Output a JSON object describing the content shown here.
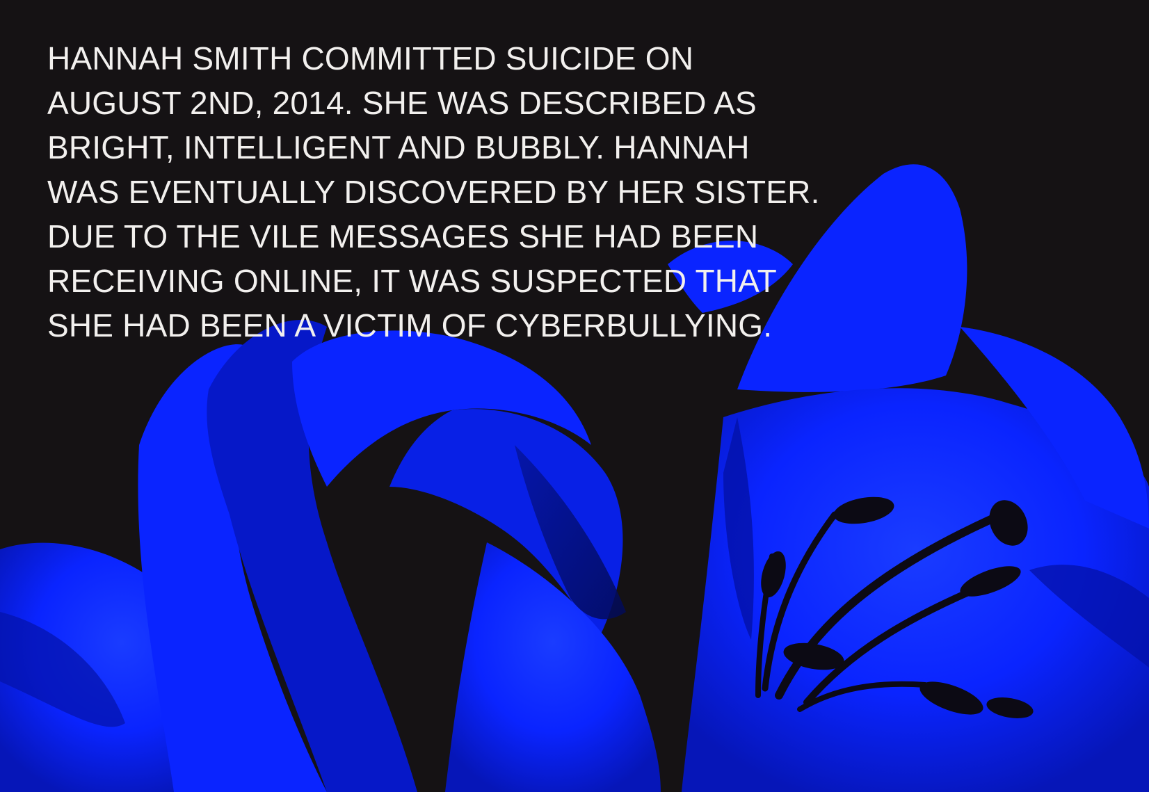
{
  "statement": {
    "lines": [
      "HANNAH SMITH COMMITTED SUICIDE ON",
      "AUGUST 2ND, 2014. SHE WAS DESCRIBED AS",
      "BRIGHT, INTELLIGENT AND BUBBLY. HANNAH",
      "WAS EVENTUALLY DISCOVERED BY HER SISTER.",
      "DUE TO THE VILE MESSAGES SHE HAD BEEN",
      "RECEIVING ONLINE, IT WAS SUSPECTED THAT",
      "SHE HAD BEEN A VICTIM OF CYBERBULLYING."
    ]
  },
  "background": {
    "base_color": "#151214",
    "flower_color": "#0a24ff",
    "flower_shadow_color": "#0412a8",
    "stamen_color": "#0c0a14",
    "text_color": "#f2f0ee"
  }
}
